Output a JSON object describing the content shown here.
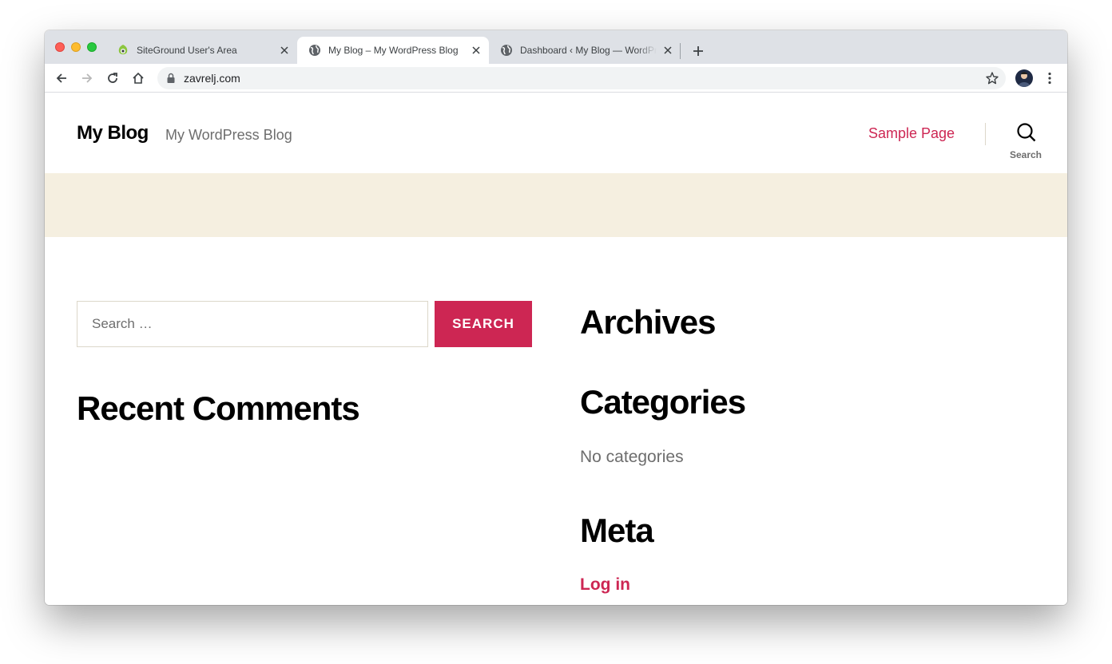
{
  "browser": {
    "tabs": [
      {
        "title": "SiteGround User's Area",
        "icon": "siteground-icon",
        "active": false
      },
      {
        "title": "My Blog – My WordPress Blog",
        "icon": "globe-icon",
        "active": true
      },
      {
        "title": "Dashboard ‹ My Blog — WordPress",
        "icon": "globe-icon",
        "active": false
      }
    ],
    "url": "zavrelj.com"
  },
  "site": {
    "title": "My Blog",
    "description": "My WordPress Blog",
    "nav_link": "Sample Page",
    "search_toggle_label": "Search",
    "accent_color": "#cd2653",
    "band_color": "#f5efe0"
  },
  "widgets": {
    "search": {
      "placeholder": "Search …",
      "button_label": "SEARCH"
    },
    "recent_comments_title": "Recent Comments",
    "archives_title": "Archives",
    "categories_title": "Categories",
    "categories_empty": "No categories",
    "meta_title": "Meta",
    "meta_link": "Log in"
  }
}
